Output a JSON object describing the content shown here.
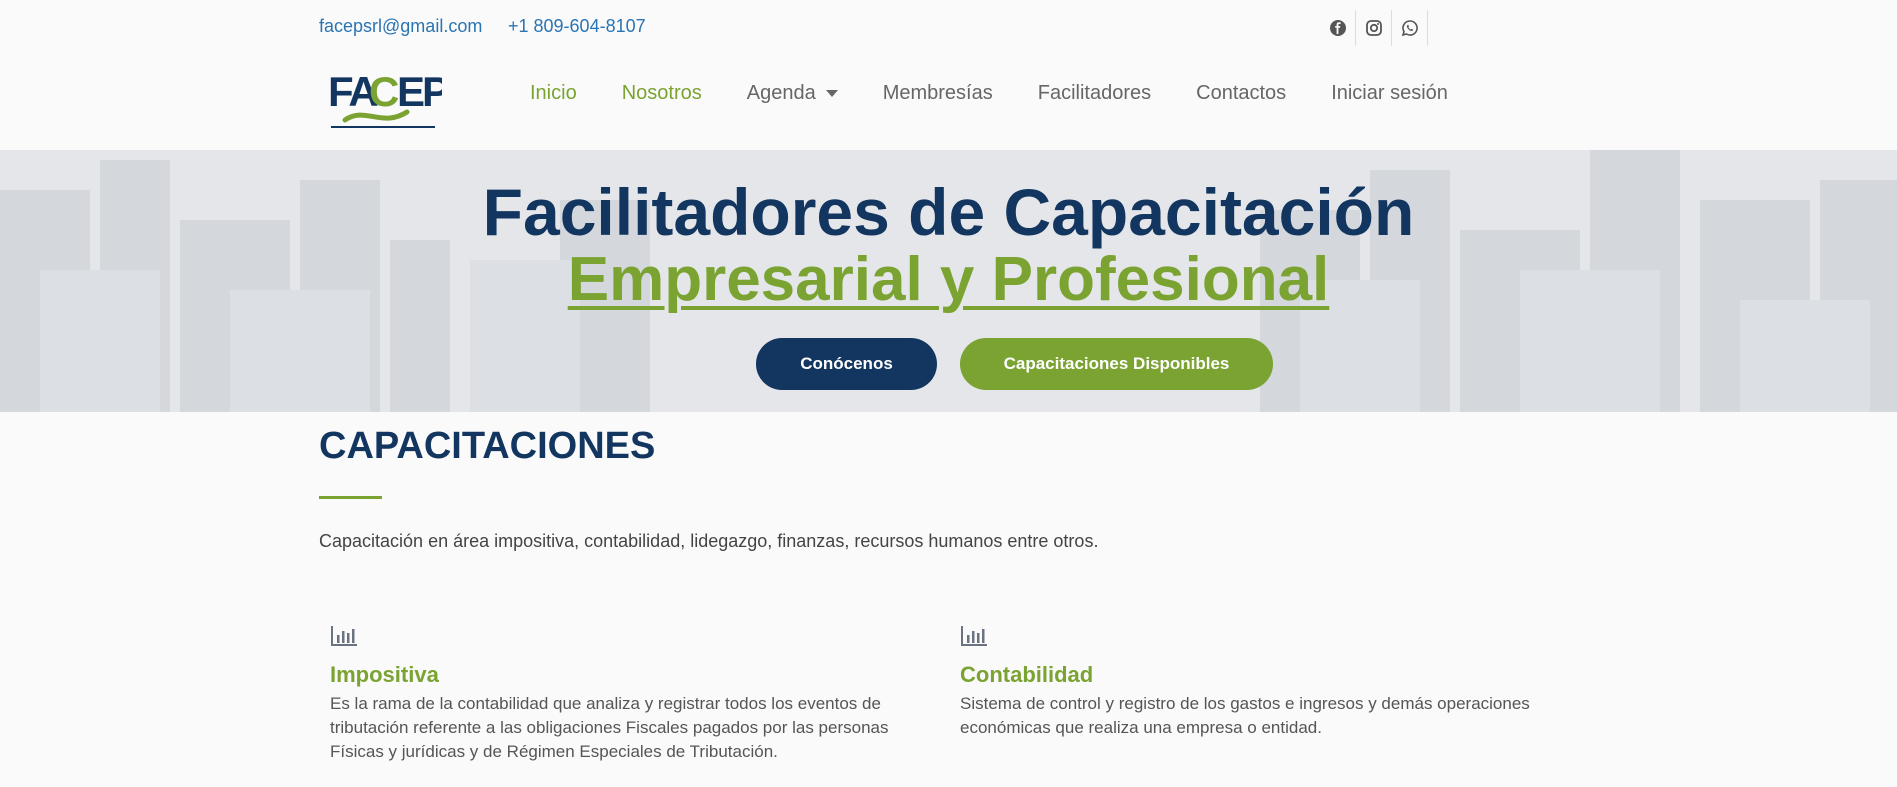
{
  "topbar": {
    "email": "facepsrl@gmail.com",
    "phone": "+1 809-604-8107",
    "socials": [
      "facebook-icon",
      "instagram-icon",
      "whatsapp-icon"
    ]
  },
  "logo": {
    "text": "FACEP"
  },
  "nav": {
    "items": [
      {
        "label": "Inicio",
        "active": true
      },
      {
        "label": "Nosotros",
        "active": true
      },
      {
        "label": "Agenda",
        "dropdown": true
      },
      {
        "label": "Membresías"
      },
      {
        "label": "Facilitadores"
      },
      {
        "label": "Contactos"
      },
      {
        "label": "Iniciar sesión"
      }
    ]
  },
  "hero": {
    "title_line1": "Facilitadores de Capacitación",
    "title_line2": "Empresarial y Profesional",
    "button_primary": "Conócenos",
    "button_secondary": "Capacitaciones Disponibles"
  },
  "section": {
    "title": "CAPACITACIONES",
    "description": "Capacitación en área impositiva, contabilidad, lidegazgo, finanzas, recursos humanos entre otros."
  },
  "cards": [
    {
      "icon": "bar-chart-icon",
      "title": "Impositiva",
      "text": "Es la rama de la contabilidad que analiza y registrar todos los eventos de tributación referente a las obligaciones Fiscales pagados por las personas Físicas y jurídicas y de Régimen Especiales de Tributación."
    },
    {
      "icon": "bar-chart-icon",
      "title": "Contabilidad",
      "text": "Sistema de control y registro de los gastos e ingresos y demás operaciones económicas que realiza una empresa o entidad."
    }
  ],
  "colors": {
    "navy": "#12365f",
    "green": "#7aa331",
    "link_blue": "#2a74b4"
  }
}
